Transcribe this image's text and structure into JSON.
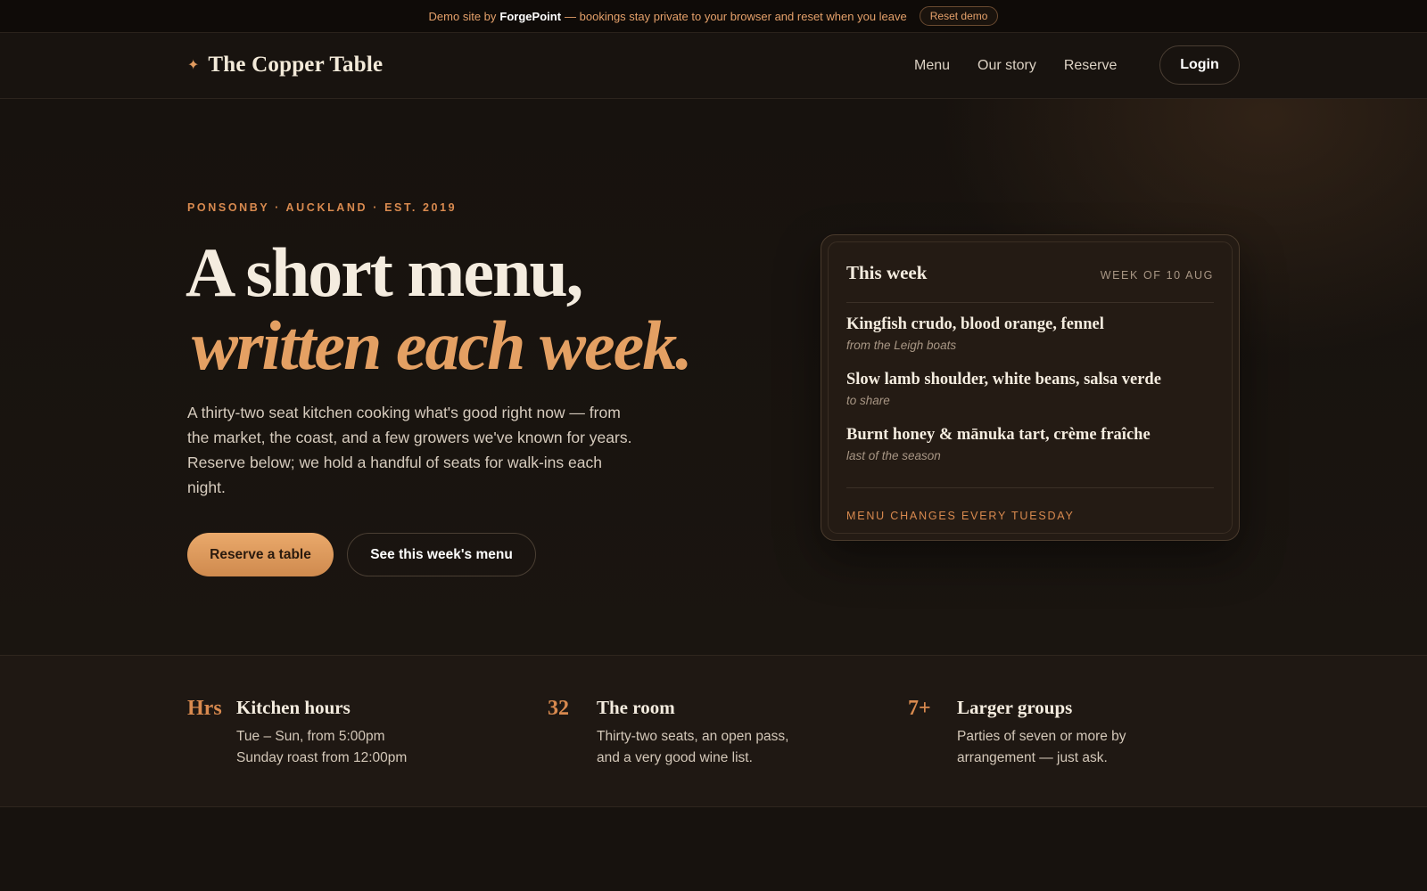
{
  "demo_banner": {
    "prefix": "Demo site by",
    "brand": "ForgePoint",
    "suffix": "— bookings stay private to your browser and reset when you leave",
    "reset_label": "Reset demo"
  },
  "header": {
    "logo_icon": "star-icon",
    "logo_text": "The Copper Table",
    "nav": [
      "Menu",
      "Our story",
      "Reserve"
    ],
    "login_label": "Login"
  },
  "hero": {
    "eyebrow": "PONSONBY · AUCKLAND · EST. 2019",
    "headline_line1": "A short menu,",
    "headline_line2": "written each week.",
    "description": "A thirty-two seat kitchen cooking what's good right now — from the market, the coast, and a few growers we've known for years. Reserve below; we hold a handful of seats for walk-ins each night.",
    "primary_cta": "Reserve a table",
    "secondary_cta": "See this week's menu"
  },
  "menu_card": {
    "title": "This week",
    "week": "WEEK OF 10 AUG",
    "dishes": [
      {
        "name": "Kingfish crudo, blood orange, fennel",
        "note": "from the Leigh boats"
      },
      {
        "name": "Slow lamb shoulder, white beans, salsa verde",
        "note": "to share"
      },
      {
        "name": "Burnt honey & mānuka tart, crème fraîche",
        "note": "last of the season"
      }
    ],
    "footer": "MENU CHANGES EVERY TUESDAY"
  },
  "info": [
    {
      "num": "Hrs",
      "title": "Kitchen hours",
      "lines": [
        "Tue – Sun, from 5:00pm",
        "Sunday roast from 12:00pm"
      ]
    },
    {
      "num": "32",
      "title": "The room",
      "lines": [
        "Thirty-two seats, an open pass,",
        "and a very good wine list."
      ]
    },
    {
      "num": "7+",
      "title": "Larger groups",
      "lines": [
        "Parties of seven or more by",
        "arrangement — just ask."
      ]
    }
  ],
  "colors": {
    "background": "#17120e",
    "accent": "#e4a063",
    "text": "#f4ecdf"
  }
}
